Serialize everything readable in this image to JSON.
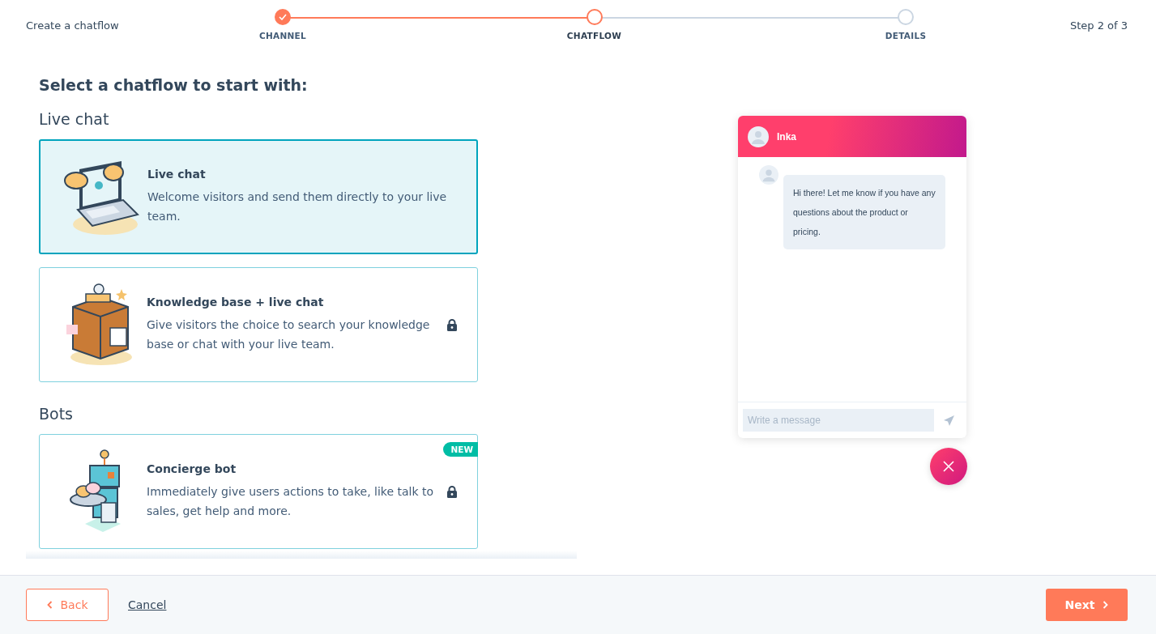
{
  "header": {
    "title": "Create a chatflow",
    "step_count": "Step 2 of 3"
  },
  "steps": [
    {
      "label": "CHANNEL",
      "completed": true,
      "selected": false
    },
    {
      "label": "CHATFLOW",
      "completed": false,
      "selected": true
    },
    {
      "label": "DETAILS",
      "completed": false,
      "selected": false
    }
  ],
  "heading": "Select a chatflow to start with:",
  "sections": [
    {
      "title": "Live chat",
      "cards": [
        {
          "kind": "laptop",
          "title": "Live chat",
          "description": "Welcome visitors and send them directly to your live team.",
          "selected": true,
          "locked": false
        },
        {
          "kind": "cabinet",
          "title": "Knowledge base + live chat",
          "description": "Give visitors the choice to search your knowledge base or chat with your live team.",
          "selected": false,
          "locked": true
        }
      ]
    },
    {
      "title": "Bots",
      "cards": [
        {
          "kind": "robot",
          "title": "Concierge bot",
          "description": "Immediately give users actions to take, like talk to sales, get help and more.",
          "selected": false,
          "locked": true,
          "badge": "NEW"
        }
      ]
    }
  ],
  "preview": {
    "agent": "Inka",
    "message": "Hi there! Let me know if you have any questions about the product or pricing.",
    "input": {
      "placeholder": "Write a message"
    }
  },
  "footer": {
    "back": "Back",
    "cancel": "Cancel",
    "next": "Next"
  }
}
